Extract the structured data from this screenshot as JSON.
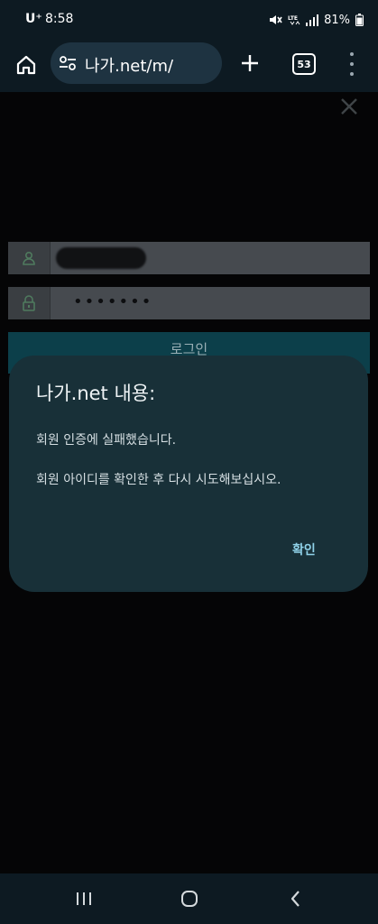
{
  "status_bar": {
    "carrier": "U⁺",
    "time": "8:58",
    "network": "LTE",
    "battery": "81%",
    "icons": [
      "mute-icon",
      "lte-icon",
      "signal-icon",
      "battery-icon"
    ]
  },
  "browser": {
    "url": "나가.net/m/",
    "tab_count": "53",
    "icons": [
      "home-icon",
      "site-settings-icon",
      "plus-icon",
      "tab-switcher-icon",
      "more-vert-icon"
    ]
  },
  "page": {
    "password_mask": "•••••••",
    "login_button_label": "로그인",
    "icons": [
      "close-icon",
      "user-icon",
      "lock-icon"
    ]
  },
  "dialog": {
    "title": "나가.net 내용:",
    "message_line1": "회원 인증에 실패했습니다.",
    "message_line2": "회원 아이디를 확인한 후 다시 시도해보십시오.",
    "confirm_label": "확인"
  },
  "nav_bar": {
    "icons": [
      "recents-icon",
      "home-circle-icon",
      "back-chevron-icon"
    ]
  },
  "colors": {
    "background": "#040406",
    "chrome": "#0d1a22",
    "url_pill": "#1e3341",
    "dialog": "#183038",
    "accent": "#8fd1e8"
  }
}
